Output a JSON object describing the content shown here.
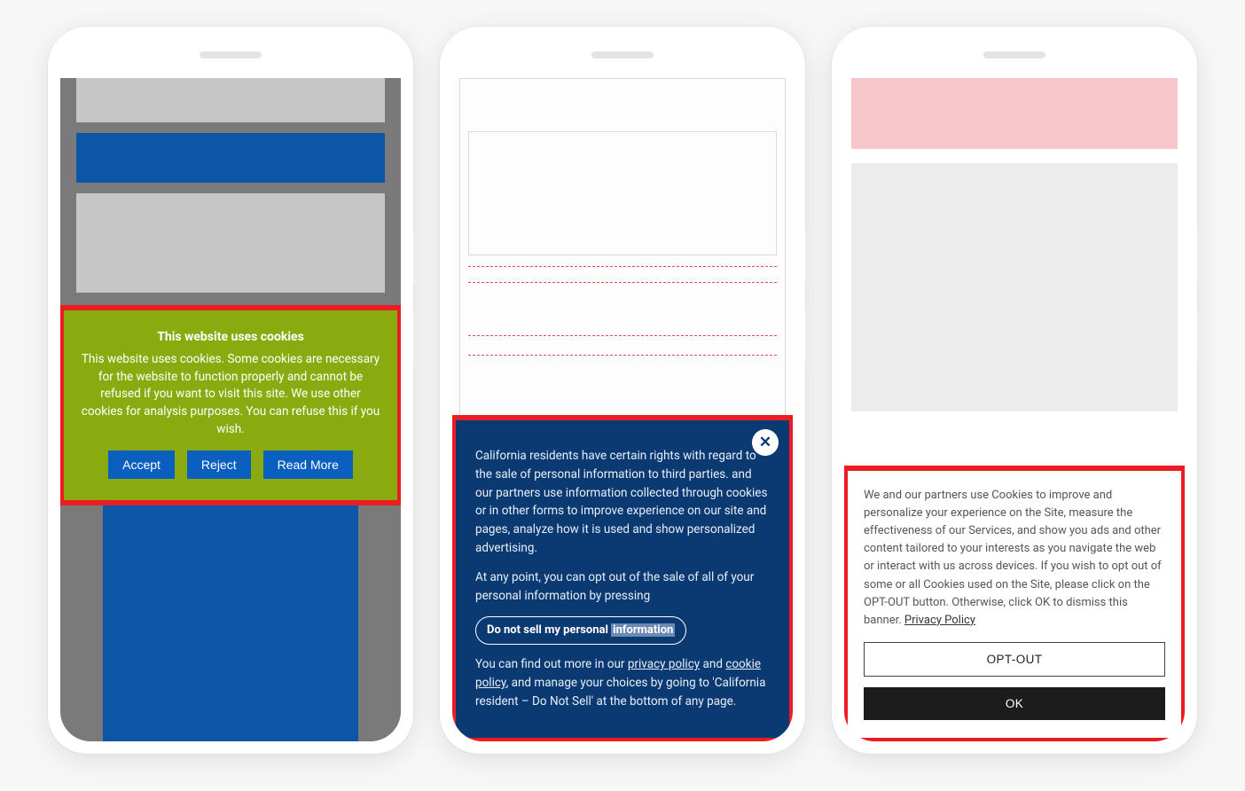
{
  "phone1": {
    "banner": {
      "title": "This website uses cookies",
      "body": "This website uses cookies. Some cookies are necessary for the website to function properly and cannot be refused if you want to visit this site. We use other cookies for analysis purposes. You can refuse this if you wish.",
      "accept": "Accept",
      "reject": "Reject",
      "read_more": "Read More"
    }
  },
  "phone2": {
    "banner": {
      "p1_a": "California residents have certain rights with regard to the sale of personal information to third parties.",
      "p1_b": " and our partners use information collected through cookies or in other forms to improve experience on our site and pages, analyze how it is used and show personalized advertising.",
      "p2": "At any point, you can opt out of the sale of all of your personal information by pressing",
      "do_not_sell_a": "Do not sell my personal ",
      "do_not_sell_b": "information",
      "p3_a": "You can find out more in our ",
      "privacy": "privacy policy",
      "and": " and ",
      "cookie": "cookie policy",
      "p3_b": ", and manage your choices by going to 'California resident – Do Not Sell' at the bottom of any page.",
      "close": "✕"
    }
  },
  "phone3": {
    "banner": {
      "body_a": "We and our partners use Cookies to improve and personalize your experience on the Site, measure the effectiveness of our Services, and show you ads and other content tailored to your interests as you navigate the web or interact with us across devices. If you wish to opt out of some or all Cookies used on the Site, please click on the OPT-OUT button. Otherwise, click OK to dismiss this banner. ",
      "privacy": "Privacy Policy",
      "optout": "OPT-OUT",
      "ok": "OK"
    }
  }
}
